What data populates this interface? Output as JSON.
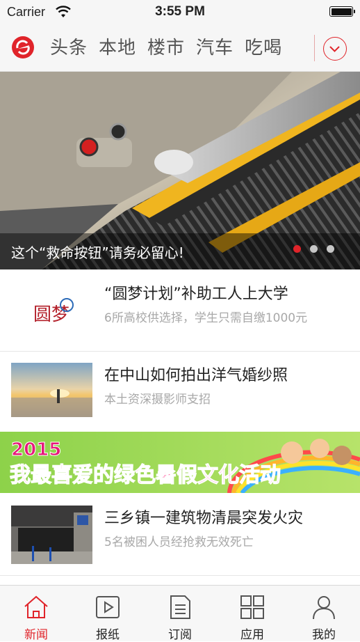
{
  "status_bar": {
    "carrier": "Carrier",
    "time": "3:55 PM"
  },
  "nav": {
    "logo_icon": "brand-logo-icon",
    "tabs": [
      {
        "label": "头条",
        "active": true
      },
      {
        "label": "本地",
        "active": false
      },
      {
        "label": "楼市",
        "active": false
      },
      {
        "label": "汽车",
        "active": false
      },
      {
        "label": "吃喝",
        "active": false
      }
    ],
    "more_icon": "chevron-down-icon",
    "accent": "#e0242a"
  },
  "hero": {
    "caption": "这个“救命按钮”请务必留心!",
    "slide_count": 3,
    "active_slide": 1
  },
  "news": [
    {
      "title": "“圆梦计划”补助工人上大学",
      "summary": "6所高校供选择，学生只需自缴1000元",
      "thumb_text": "圆梦"
    },
    {
      "title": "在中山如何拍出洋气婚纱照",
      "summary": "本土资深摄影师支招"
    },
    {
      "title": "三乡镇一建筑物清晨突发火灾",
      "summary": "5名被困人员经抢救无效死亡"
    }
  ],
  "banner": {
    "year": "2015",
    "text": "我最喜爱的绿色暑假文化活动"
  },
  "tabbar": [
    {
      "label": "新闻",
      "icon": "home-icon",
      "active": true
    },
    {
      "label": "报纸",
      "icon": "play-icon",
      "active": false
    },
    {
      "label": "订阅",
      "icon": "document-icon",
      "active": false
    },
    {
      "label": "应用",
      "icon": "apps-grid-icon",
      "active": false
    },
    {
      "label": "我的",
      "icon": "user-icon",
      "active": false
    }
  ]
}
